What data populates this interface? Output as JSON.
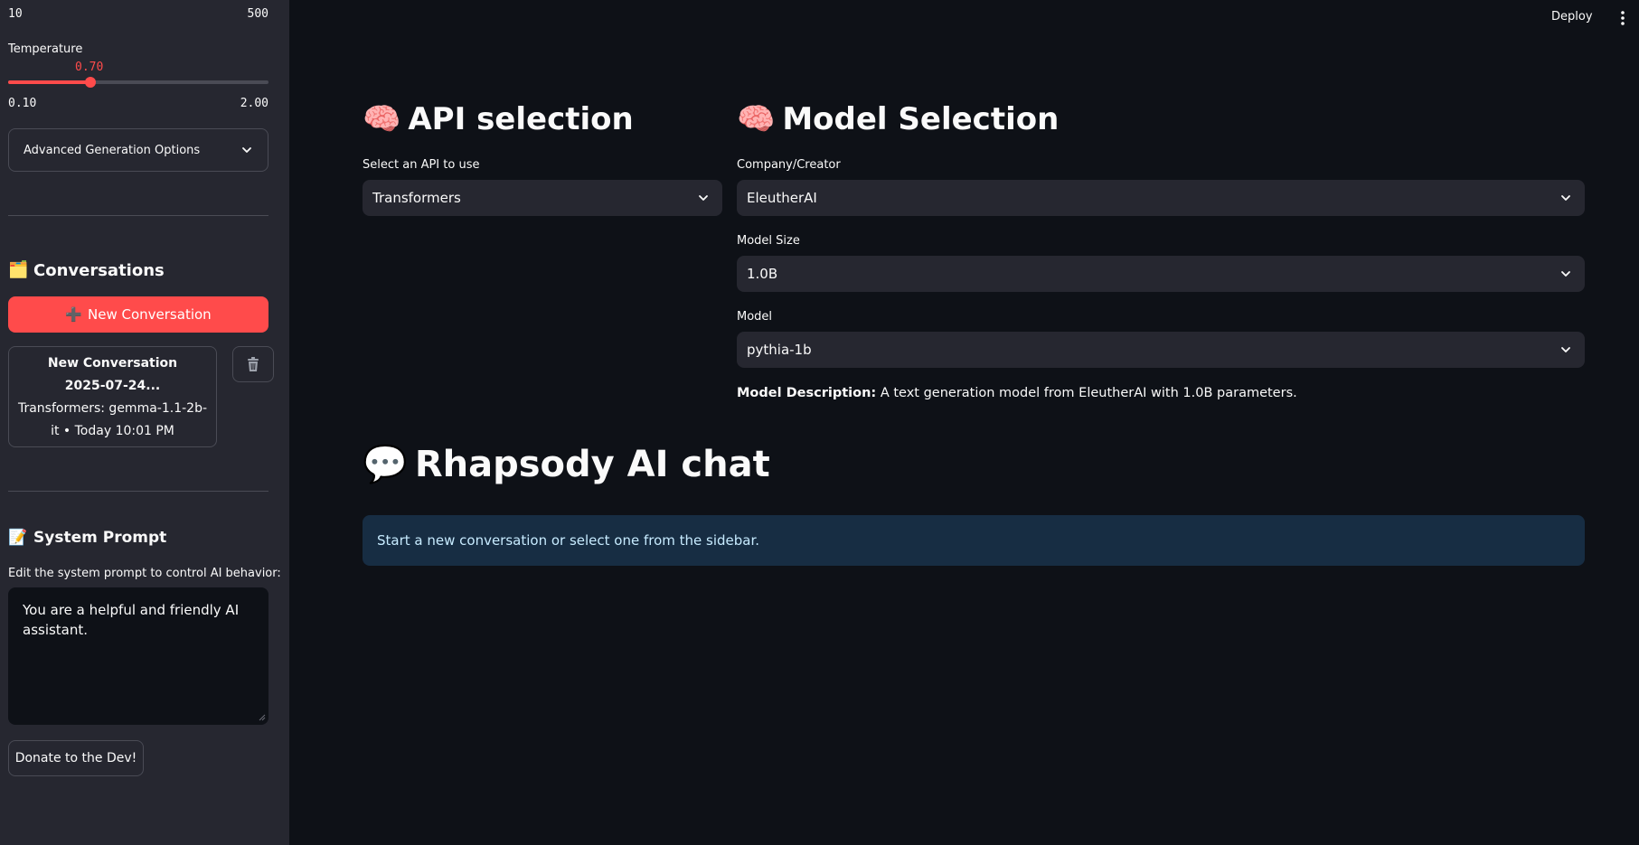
{
  "sidebar": {
    "max_tokens_slider": {
      "min_label": "10",
      "max_label": "500"
    },
    "temperature": {
      "label": "Temperature",
      "value_label": "0.70",
      "value": 0.7,
      "min_label": "0.10",
      "max_label": "2.00",
      "min": 0.1,
      "max": 2.0
    },
    "advanced_options_label": "Advanced Generation Options",
    "conversations": {
      "emoji": "🗂️",
      "title": "Conversations",
      "new_button_icon": "➕",
      "new_button_label": "New Conversation",
      "items": [
        {
          "title_line1": "New Conversation",
          "title_line2": "2025-07-24...",
          "meta_line1": "Transformers: gemma-1.1-2b-",
          "meta_line2": "it • Today 10:01 PM"
        }
      ]
    },
    "system_prompt": {
      "emoji": "📝",
      "title": "System Prompt",
      "caption": "Edit the system prompt to control AI behavior:",
      "value": "You are a helpful and friendly AI assistant."
    },
    "donate_label": "Donate to the Dev!"
  },
  "header": {
    "deploy_label": "Deploy"
  },
  "main": {
    "api_selection": {
      "emoji": "🧠",
      "title": "API selection",
      "select_label": "Select an API to use",
      "selected": "Transformers"
    },
    "model_selection": {
      "emoji": "🧠",
      "title": "Model Selection",
      "company_label": "Company/Creator",
      "company_value": "EleutherAI",
      "size_label": "Model Size",
      "size_value": "1.0B",
      "model_label": "Model",
      "model_value": "pythia-1b",
      "description_label": "Model Description:",
      "description_text": " A text generation model from EleutherAI with 1.0B parameters."
    },
    "chat": {
      "emoji": "💬",
      "title": "Rhapsody AI chat",
      "info_message": "Start a new conversation or select one from the sidebar."
    }
  },
  "colors": {
    "accent": "#ff4b4b",
    "background": "#0e1117",
    "sidebar": "#262730",
    "info_bg": "#172d43",
    "info_text": "#c7ebff"
  },
  "icons": {
    "dropdown": "chevron-down-icon",
    "delete": "trash-icon",
    "menu": "kebab-menu-icon"
  }
}
